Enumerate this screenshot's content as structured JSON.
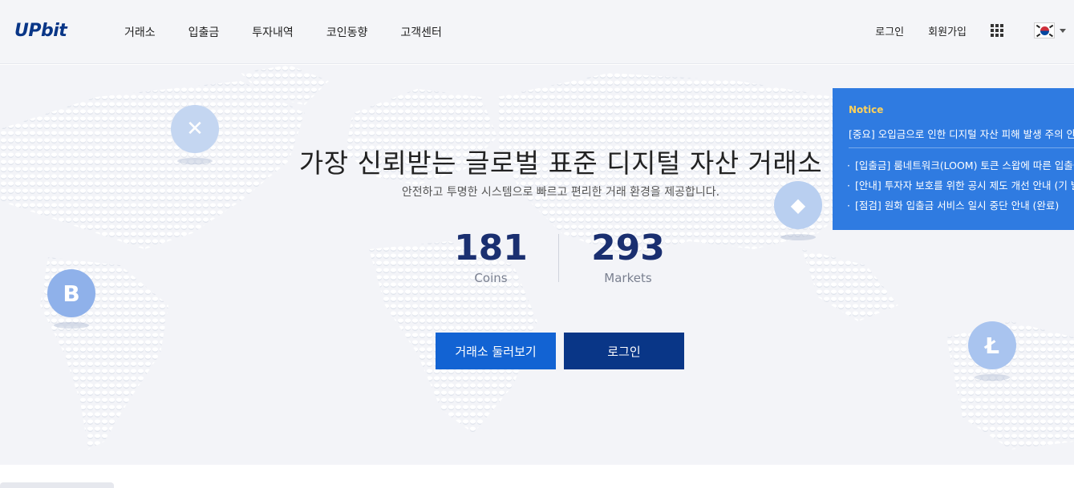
{
  "header": {
    "logo": "UPbit",
    "nav": [
      "거래소",
      "입출금",
      "투자내역",
      "코인동향",
      "고객센터"
    ],
    "login": "로그인",
    "signup": "회원가입"
  },
  "hero": {
    "headline": "가장 신뢰받는 글로벌 표준 디지털 자산 거래소",
    "subline": "안전하고 투명한 시스템으로 빠르고 편리한 거래 환경을 제공합니다.",
    "stats": [
      {
        "value": "181",
        "label": "Coins"
      },
      {
        "value": "293",
        "label": "Markets"
      }
    ],
    "explore_button": "거래소 둘러보기",
    "login_button": "로그인"
  },
  "coins": [
    {
      "icon": "ripple-icon",
      "glyph": "✕"
    },
    {
      "icon": "ethereum-icon",
      "glyph": "◆"
    },
    {
      "icon": "bitcoin-icon",
      "glyph": "B"
    },
    {
      "icon": "litecoin-icon",
      "glyph": "Ł"
    }
  ],
  "notice": {
    "title": "Notice",
    "main": "[중요] 오입금으로 인한 디지털 자산 피해 발생 주의 안내",
    "items": [
      "[입출금] 룸네트워크(LOOM) 토큰 스왑에 따른 입출금 일시 중단 안내",
      "[안내] 투자자 보호를 위한 공시 제도 개선 안내 (기 발행 공시)",
      "[점검] 원화 입출금 서비스 일시 중단 안내 (완료)"
    ]
  },
  "colors": {
    "brand": "#093687",
    "primary_button": "#1263d3",
    "notice_bg": "#2f7be1",
    "notice_title": "#ffd25a"
  }
}
